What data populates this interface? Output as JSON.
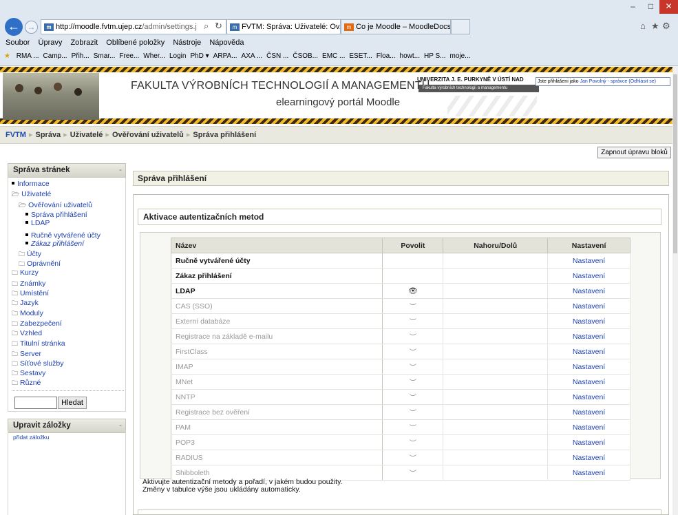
{
  "browser": {
    "url_host": "http://moodle.fvtm.ujep.cz",
    "url_rest": "/admin/settings.j",
    "tab_active": "FVTM: Správa: Uživatelé: Ov...",
    "tab_other": "Co je Moodle – MoodleDocs",
    "tab_favicon": "m",
    "menu": [
      "Soubor",
      "Úpravy",
      "Zobrazit",
      "Oblíbené položky",
      "Nástroje",
      "Nápověda"
    ],
    "favorites": [
      "RMA ...",
      "Camp...",
      "Přih...",
      "Smar...",
      "Free...",
      "Wher...",
      "Login",
      "PhD ▾",
      "ARPA...",
      "AXA ...",
      "ČSN ...",
      "ČSOB...",
      "EMC ...",
      "ESET...",
      "Floa...",
      "howt...",
      "HP S...",
      "moje..."
    ]
  },
  "header": {
    "faculty": "FAKULTA VÝROBNÍCH TECHNOLOGIÍ A MANAGEMENTU",
    "portal": "elearningový portál Moodle",
    "university": "UNIVERZITA J. E. PURKYNĚ V ÚSTÍ NAD",
    "university_sub": "Fakulta výrobních technologií a managementu",
    "login_prefix": "Jste přihlášeni jako",
    "login_user": "Jan Povolný - správce",
    "logout": "(Odhlásit se)"
  },
  "breadcrumb": [
    "FVTM",
    "Správa",
    "Uživatelé",
    "Ověřování uživatelů",
    "Správa přihlášení"
  ],
  "edit_blocks": "Zapnout úpravu bloků",
  "sidebar": {
    "title": "Správa stránek",
    "items": [
      {
        "label": "Informace",
        "level": 0,
        "icon": "bullet"
      },
      {
        "label": "Uživatelé",
        "level": 0,
        "icon": "folder-open"
      },
      {
        "label": "Ověřování uživatelů",
        "level": 1,
        "icon": "folder-open"
      },
      {
        "label": "Správa přihlášení",
        "level": 2,
        "icon": "bullet"
      },
      {
        "label": "LDAP",
        "level": 2,
        "icon": "bullet"
      },
      {
        "label": "Ručně vytvářené účty",
        "level": 2,
        "icon": "bullet"
      },
      {
        "label": "Zákaz přihlášení",
        "level": 2,
        "icon": "bullet",
        "italic": true
      },
      {
        "label": "Účty",
        "level": 1,
        "icon": "folder"
      },
      {
        "label": "Oprávnění",
        "level": 1,
        "icon": "folder"
      },
      {
        "label": "Kurzy",
        "level": 0,
        "icon": "folder"
      },
      {
        "label": "Známky",
        "level": 0,
        "icon": "folder"
      },
      {
        "label": "Umístění",
        "level": 0,
        "icon": "folder"
      },
      {
        "label": "Jazyk",
        "level": 0,
        "icon": "folder"
      },
      {
        "label": "Moduly",
        "level": 0,
        "icon": "folder"
      },
      {
        "label": "Zabezpečení",
        "level": 0,
        "icon": "folder"
      },
      {
        "label": "Vzhled",
        "level": 0,
        "icon": "folder"
      },
      {
        "label": "Titulní stránka",
        "level": 0,
        "icon": "folder"
      },
      {
        "label": "Server",
        "level": 0,
        "icon": "folder"
      },
      {
        "label": "Síťové služby",
        "level": 0,
        "icon": "folder"
      },
      {
        "label": "Sestavy",
        "level": 0,
        "icon": "folder"
      },
      {
        "label": "Různé",
        "level": 0,
        "icon": "folder"
      }
    ],
    "search_button": "Hledat",
    "bookmarks_title": "Upravit záložky",
    "bookmarks_add": "přidat záložku",
    "hide_symbol": "-"
  },
  "main": {
    "title": "Správa přihlášení",
    "section": "Aktivace autentizačních metod",
    "columns": [
      "Název",
      "Povolit",
      "Nahoru/Dolů",
      "Nastavení"
    ],
    "rows": [
      {
        "name": "Ručně vytvářené účty",
        "state": "fixed",
        "setting": "Nastavení"
      },
      {
        "name": "Zákaz přihlášení",
        "state": "fixed",
        "setting": "Nastavení"
      },
      {
        "name": "LDAP",
        "state": "enabled",
        "setting": "Nastavení"
      },
      {
        "name": "CAS (SSO)",
        "state": "disabled",
        "setting": "Nastavení"
      },
      {
        "name": "Externí databáze",
        "state": "disabled",
        "setting": "Nastavení"
      },
      {
        "name": "Registrace na základě e-mailu",
        "state": "disabled",
        "setting": "Nastavení"
      },
      {
        "name": "FirstClass",
        "state": "disabled",
        "setting": "Nastavení"
      },
      {
        "name": "IMAP",
        "state": "disabled",
        "setting": "Nastavení"
      },
      {
        "name": "MNet",
        "state": "disabled",
        "setting": "Nastavení"
      },
      {
        "name": "NNTP",
        "state": "disabled",
        "setting": "Nastavení"
      },
      {
        "name": "Registrace bez ověření",
        "state": "disabled",
        "setting": "Nastavení"
      },
      {
        "name": "PAM",
        "state": "disabled",
        "setting": "Nastavení"
      },
      {
        "name": "POP3",
        "state": "disabled",
        "setting": "Nastavení"
      },
      {
        "name": "RADIUS",
        "state": "disabled",
        "setting": "Nastavení"
      },
      {
        "name": "Shibboleth",
        "state": "disabled",
        "setting": "Nastavení"
      }
    ],
    "note_line1": "Aktivujte autentizační metody a pořadí, v jakém budou použity.",
    "note_line2": "Změny v tabulce výše jsou ukládány automaticky."
  }
}
